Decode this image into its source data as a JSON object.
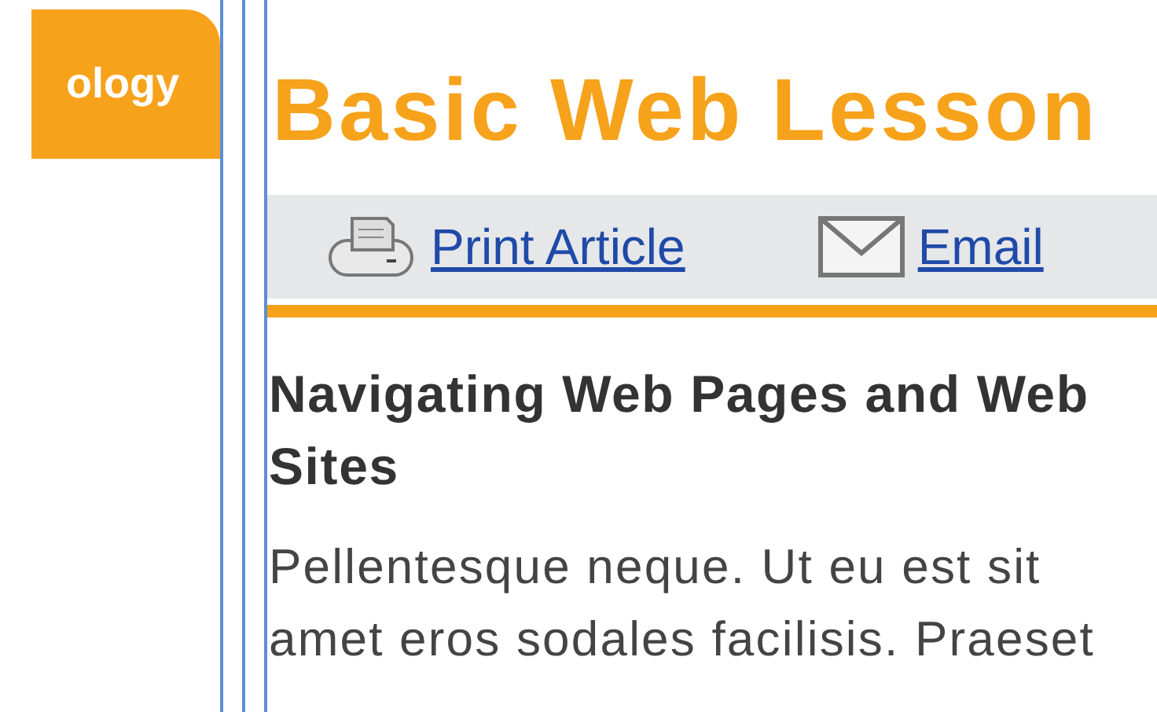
{
  "section_tab": {
    "label": "ology"
  },
  "page_title": "Basic Web Lesson",
  "toolbar": {
    "links": [
      {
        "kind": "print",
        "label": "Print Article"
      },
      {
        "kind": "email",
        "label": "Email"
      }
    ]
  },
  "article": {
    "heading": "Navigating Web Pages and Web Sites",
    "paragraph": "Pellentesque neque. Ut eu est sit amet eros sodales facilisis. Praeset"
  }
}
